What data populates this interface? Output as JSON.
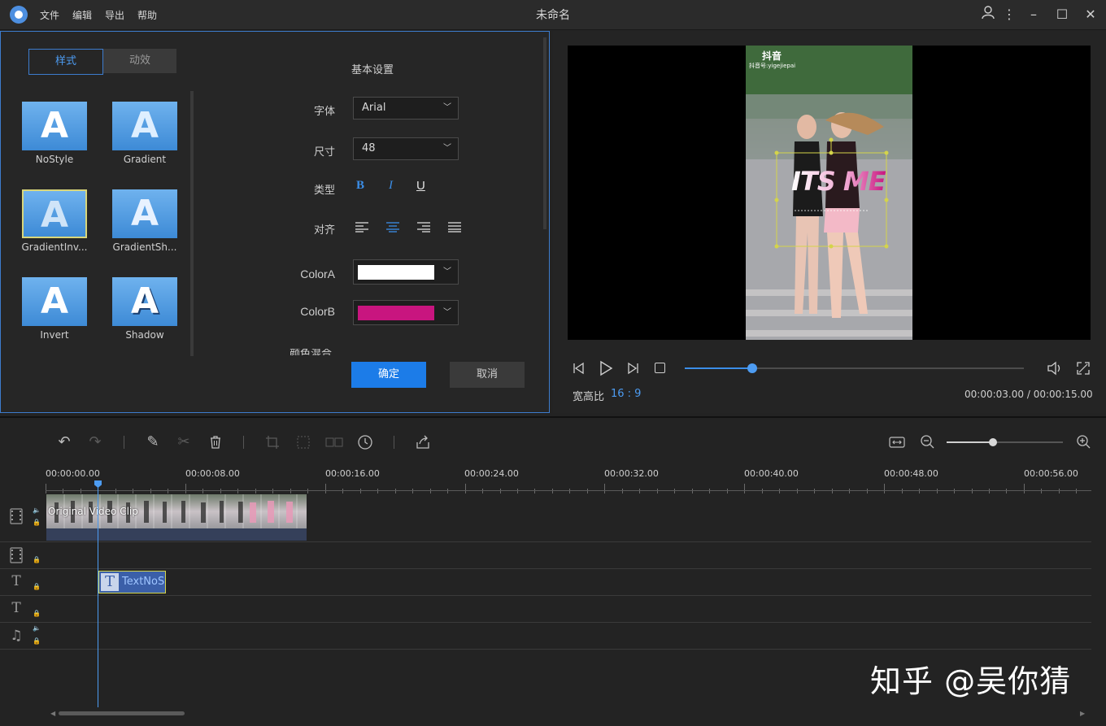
{
  "menu": [
    "文件",
    "编辑",
    "导出",
    "帮助"
  ],
  "window_title": "未命名",
  "window_controls": [
    "user-icon",
    "more-icon",
    "minimize-icon",
    "maximize-icon",
    "close-icon"
  ],
  "left_panel": {
    "tabs": {
      "style": "样式",
      "animation": "动效"
    },
    "styles": [
      "NoStyle",
      "Gradient",
      "GradientInv...",
      "GradientSh...",
      "Invert",
      "Shadow"
    ],
    "tile_glyph": "A",
    "selected_style": "GradientInv...",
    "settings_title": "基本设置",
    "font_label": "字体",
    "font_value": "Arial",
    "size_label": "尺寸",
    "size_value": "48",
    "type_label": "类型",
    "type_buttons": [
      "B",
      "I",
      "U"
    ],
    "align_label": "对齐",
    "color_a_label": "ColorA",
    "color_a": "#ffffff",
    "color_b_label": "ColorB",
    "color_b": "#c8157f",
    "blend_label": "颜色混合",
    "confirm": "确定",
    "cancel": "取消"
  },
  "preview": {
    "watermark_app": "抖音",
    "watermark_id": "抖音号:yigejiepai",
    "overlay_text": "ITS ME",
    "aspect_label": "宽高比",
    "aspect_value": "16 : 9",
    "current_time": "00:00:03.00",
    "time_sep": "/",
    "total_time": "00:00:15.00",
    "progress": 0.2
  },
  "timeline": {
    "ruler": [
      "00:00:00.00",
      "00:00:08.00",
      "00:00:16.00",
      "00:00:24.00",
      "00:00:32.00",
      "00:00:40.00",
      "00:00:48.00",
      "00:00:56.00"
    ],
    "video_clip_label": "Original Video Clip",
    "text_clip_label": "TextNoS",
    "zoom": 0.4
  },
  "corner_watermark": "知乎 @吴你猜"
}
